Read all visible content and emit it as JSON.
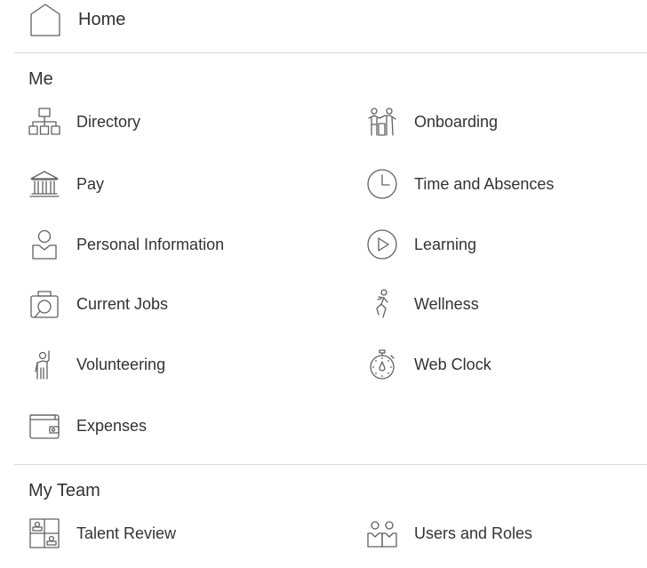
{
  "home": {
    "label": "Home",
    "icon": "home-icon"
  },
  "sections": {
    "me": {
      "title": "Me",
      "items": [
        {
          "label": "Directory",
          "icon": "org-chart-icon"
        },
        {
          "label": "Onboarding",
          "icon": "onboarding-icon"
        },
        {
          "label": "Pay",
          "icon": "bank-icon"
        },
        {
          "label": "Time and Absences",
          "icon": "clock-icon"
        },
        {
          "label": "Personal Information",
          "icon": "person-icon"
        },
        {
          "label": "Learning",
          "icon": "play-icon"
        },
        {
          "label": "Current Jobs",
          "icon": "job-search-icon"
        },
        {
          "label": "Wellness",
          "icon": "wellness-icon"
        },
        {
          "label": "Volunteering",
          "icon": "volunteer-icon"
        },
        {
          "label": "Web Clock",
          "icon": "stopwatch-icon"
        },
        {
          "label": "Expenses",
          "icon": "wallet-icon"
        }
      ]
    },
    "my_team": {
      "title": "My Team",
      "items": [
        {
          "label": "Talent Review",
          "icon": "talent-review-icon"
        },
        {
          "label": "Users and Roles",
          "icon": "users-roles-icon"
        }
      ]
    }
  },
  "colors": {
    "text": "#333333",
    "icon": "#606060",
    "divider": "#d9d9d9",
    "background": "#ffffff"
  }
}
